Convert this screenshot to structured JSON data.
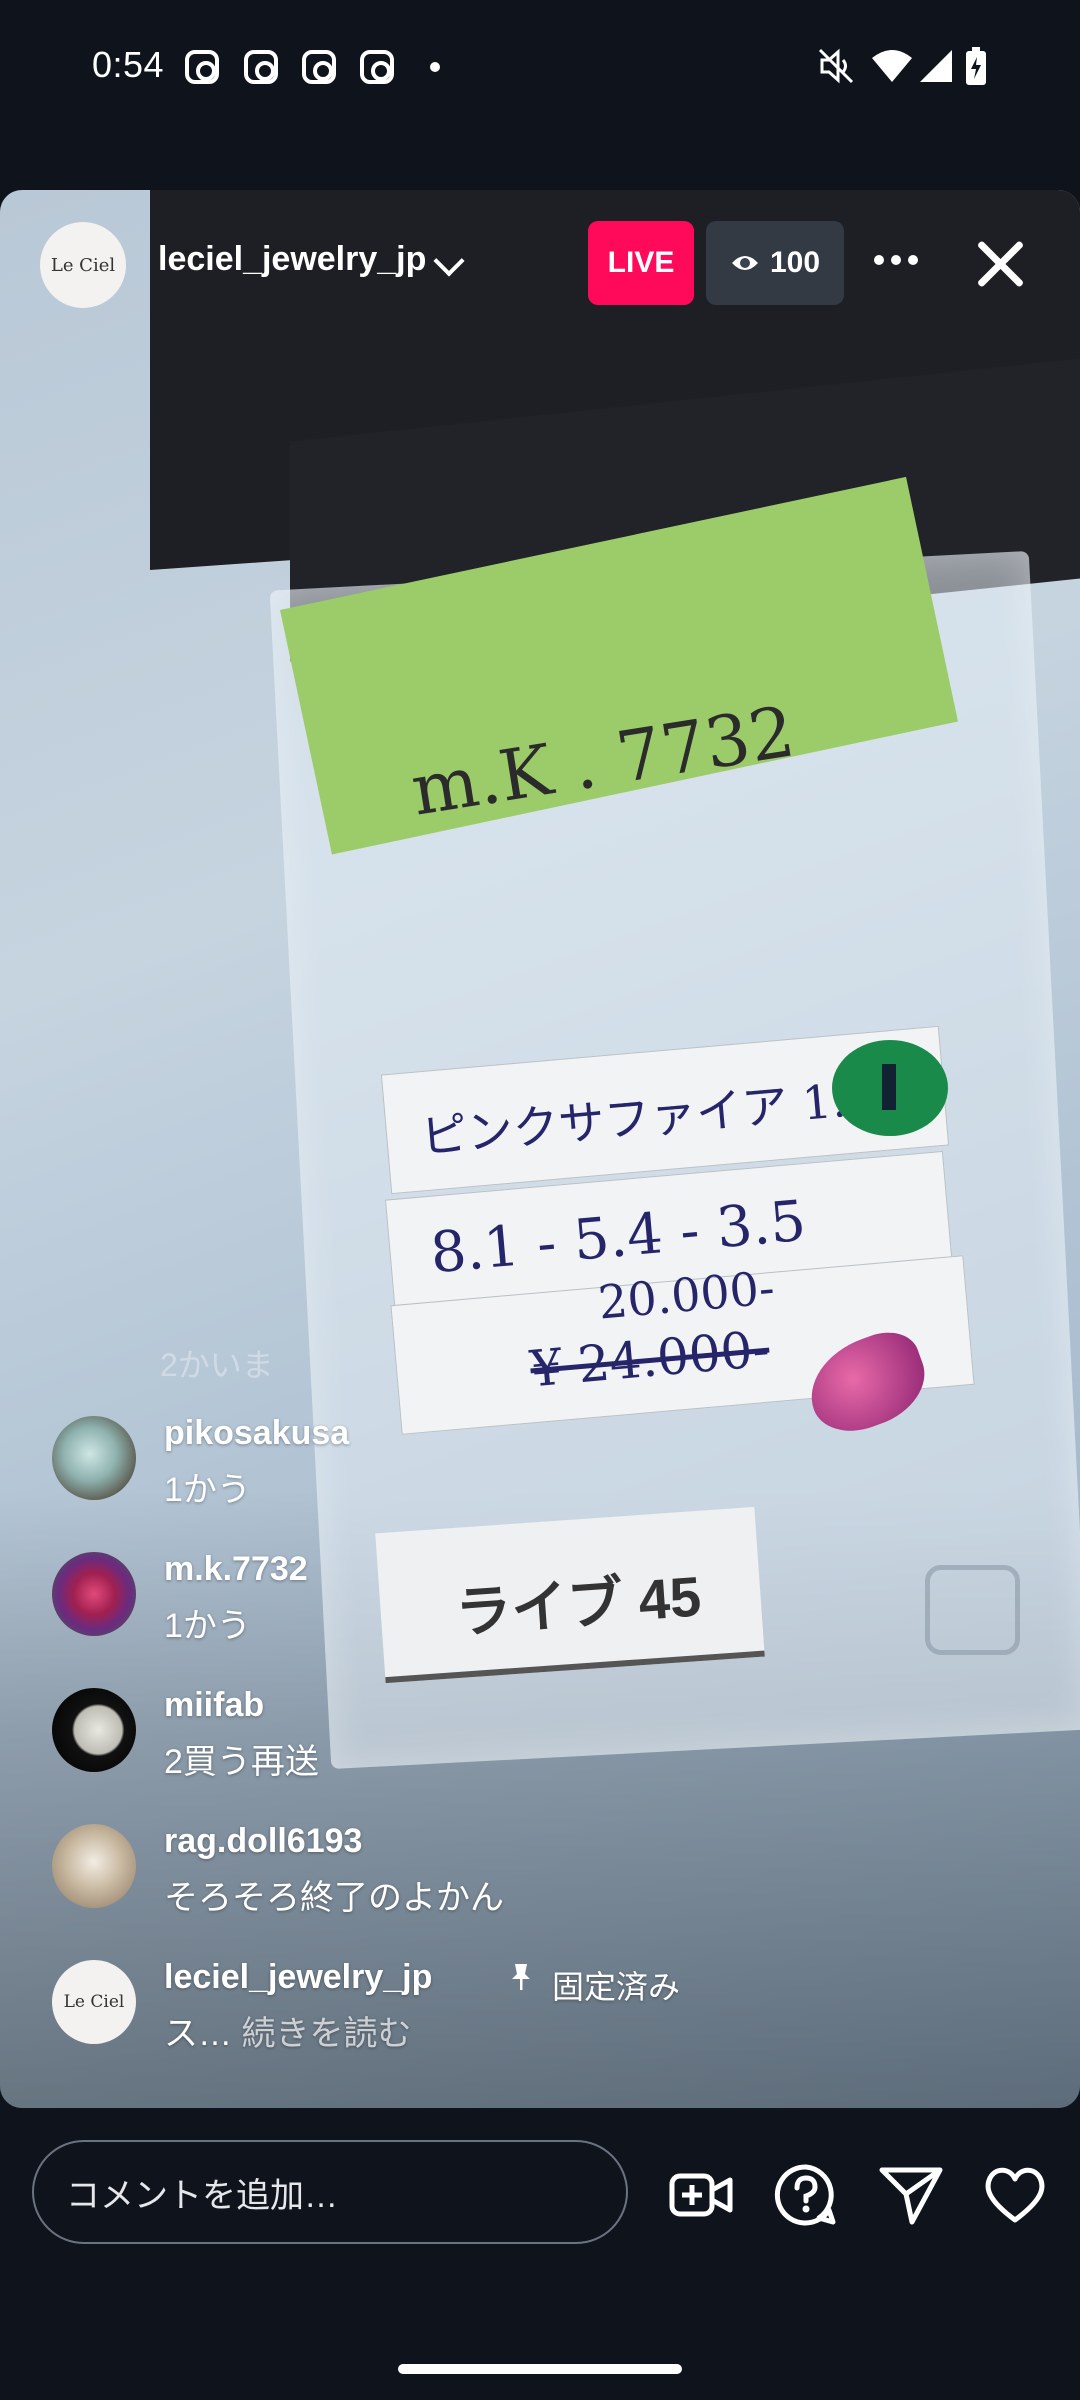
{
  "status_bar": {
    "time": "0:54",
    "notification_icons": [
      "instagram-icon",
      "instagram-icon",
      "instagram-icon",
      "instagram-icon"
    ],
    "right_icons": [
      "mute-icon",
      "wifi-icon",
      "cell-signal-icon",
      "battery-charging-icon"
    ]
  },
  "live": {
    "host_avatar_text": "Le Ciel",
    "host_username": "leciel_jewelry_jp",
    "live_label": "LIVE",
    "viewer_count": "100"
  },
  "video_scene": {
    "sticky_note_text": "m.K . 7732",
    "label_line_1": "ピンクサファイア 1.23",
    "label_line_2": "8.1 - 5.4 - 3.5",
    "label_line_3": "20.000-",
    "label_line_4": "¥ 24.000-",
    "card_text": "ライブ 45"
  },
  "comments": [
    {
      "user": "pikosakusa",
      "text": "1かう"
    },
    {
      "user": "m.k.7732",
      "text": "1かう"
    },
    {
      "user": "miifab",
      "text": "2買う再送"
    },
    {
      "user": "rag.doll6193",
      "text": "そろそろ終了のよかん"
    }
  ],
  "partial_comment": "2かいま",
  "pinned_comment": {
    "user": "leciel_jewelry_jp",
    "avatar_text": "Le Ciel",
    "pin_label": "固定済み",
    "text": "ス…",
    "more_label": "続きを読む"
  },
  "bottom_bar": {
    "comment_placeholder": "コメントを追加…"
  },
  "colors": {
    "live_badge": "#ff0a5a",
    "background": "#0f141c"
  }
}
